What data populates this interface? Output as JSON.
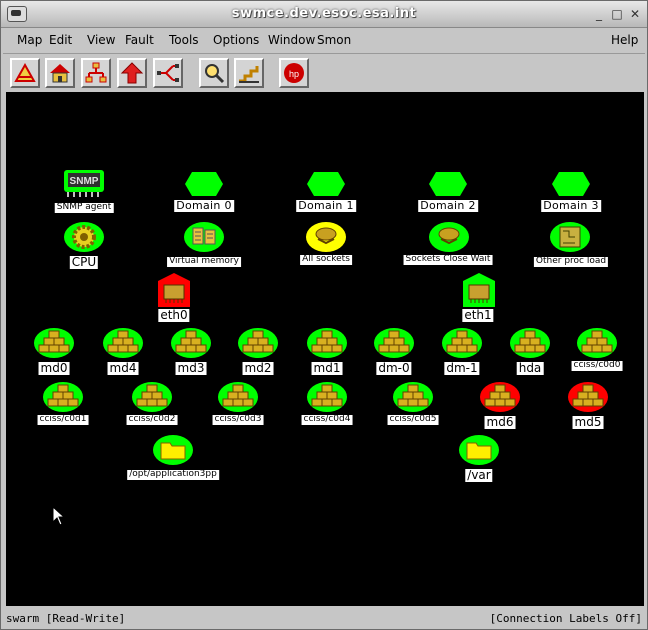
{
  "window": {
    "title": "swmce.dev.esoc.esa.int"
  },
  "menu": {
    "items": [
      {
        "label": "Map"
      },
      {
        "label": "Edit"
      },
      {
        "label": "View"
      },
      {
        "label": "Fault"
      },
      {
        "label": "Tools"
      },
      {
        "label": "Options"
      },
      {
        "label": "Window"
      },
      {
        "label": "Smon"
      }
    ],
    "help": "Help"
  },
  "toolbar": {
    "buttons": [
      "home-up-icon",
      "house-icon",
      "hierarchy-icon",
      "up-arrow-icon",
      "network-link-icon",
      "magnifier-icon",
      "stairs-icon",
      "hp-openview-icon"
    ]
  },
  "map": {
    "nodes": [
      {
        "id": "snmp",
        "label": "SNMP agent",
        "shape": "snmp",
        "status": "green"
      },
      {
        "id": "d0",
        "label": "Domain 0",
        "shape": "hexagon",
        "status": "green"
      },
      {
        "id": "d1",
        "label": "Domain 1",
        "shape": "hexagon",
        "status": "green"
      },
      {
        "id": "d2",
        "label": "Domain 2",
        "shape": "hexagon",
        "status": "green"
      },
      {
        "id": "d3",
        "label": "Domain 3",
        "shape": "hexagon",
        "status": "green"
      },
      {
        "id": "cpu",
        "label": "CPU",
        "shape": "gear",
        "status": "green"
      },
      {
        "id": "vm",
        "label": "Virtual memory",
        "shape": "memory",
        "status": "green"
      },
      {
        "id": "as",
        "label": "All sockets",
        "shape": "socket",
        "status": "yellow"
      },
      {
        "id": "scw",
        "label": "Sockets Close Wait",
        "shape": "socket",
        "status": "green"
      },
      {
        "id": "opl",
        "label": "Other proc load",
        "shape": "process",
        "status": "green"
      },
      {
        "id": "eth0",
        "label": "eth0",
        "shape": "nic",
        "status": "red"
      },
      {
        "id": "eth1",
        "label": "eth1",
        "shape": "nic",
        "status": "green"
      },
      {
        "id": "md0",
        "label": "md0",
        "shape": "disk",
        "status": "green"
      },
      {
        "id": "md4",
        "label": "md4",
        "shape": "disk",
        "status": "green"
      },
      {
        "id": "md3",
        "label": "md3",
        "shape": "disk",
        "status": "green"
      },
      {
        "id": "md2",
        "label": "md2",
        "shape": "disk",
        "status": "green"
      },
      {
        "id": "md1",
        "label": "md1",
        "shape": "disk",
        "status": "green"
      },
      {
        "id": "dm0",
        "label": "dm-0",
        "shape": "disk",
        "status": "green"
      },
      {
        "id": "dm1",
        "label": "dm-1",
        "shape": "disk",
        "status": "green"
      },
      {
        "id": "hda",
        "label": "hda",
        "shape": "disk",
        "status": "green"
      },
      {
        "id": "c0d0",
        "label": "cciss/c0d0",
        "shape": "disk",
        "status": "green"
      },
      {
        "id": "c0d1",
        "label": "cciss/c0d1",
        "shape": "disk",
        "status": "green"
      },
      {
        "id": "c0d2",
        "label": "cciss/c0d2",
        "shape": "disk",
        "status": "green"
      },
      {
        "id": "c0d3",
        "label": "cciss/c0d3",
        "shape": "disk",
        "status": "green"
      },
      {
        "id": "c0d4",
        "label": "cciss/c0d4",
        "shape": "disk",
        "status": "green"
      },
      {
        "id": "c0d5",
        "label": "cciss/c0d5",
        "shape": "disk",
        "status": "green"
      },
      {
        "id": "md6",
        "label": "md6",
        "shape": "disk",
        "status": "red"
      },
      {
        "id": "md5",
        "label": "md5",
        "shape": "disk",
        "status": "red"
      },
      {
        "id": "opt",
        "label": "/opt/application3pp",
        "shape": "folder",
        "status": "green"
      },
      {
        "id": "var",
        "label": "/var",
        "shape": "folder",
        "status": "green"
      }
    ]
  },
  "status": {
    "left": "swarm [Read-Write]",
    "right": "[Connection Labels Off]"
  },
  "colors": {
    "green": "#00ff00",
    "yellow": "#ffff00",
    "red": "#ff0000",
    "canvas": "#000000"
  }
}
